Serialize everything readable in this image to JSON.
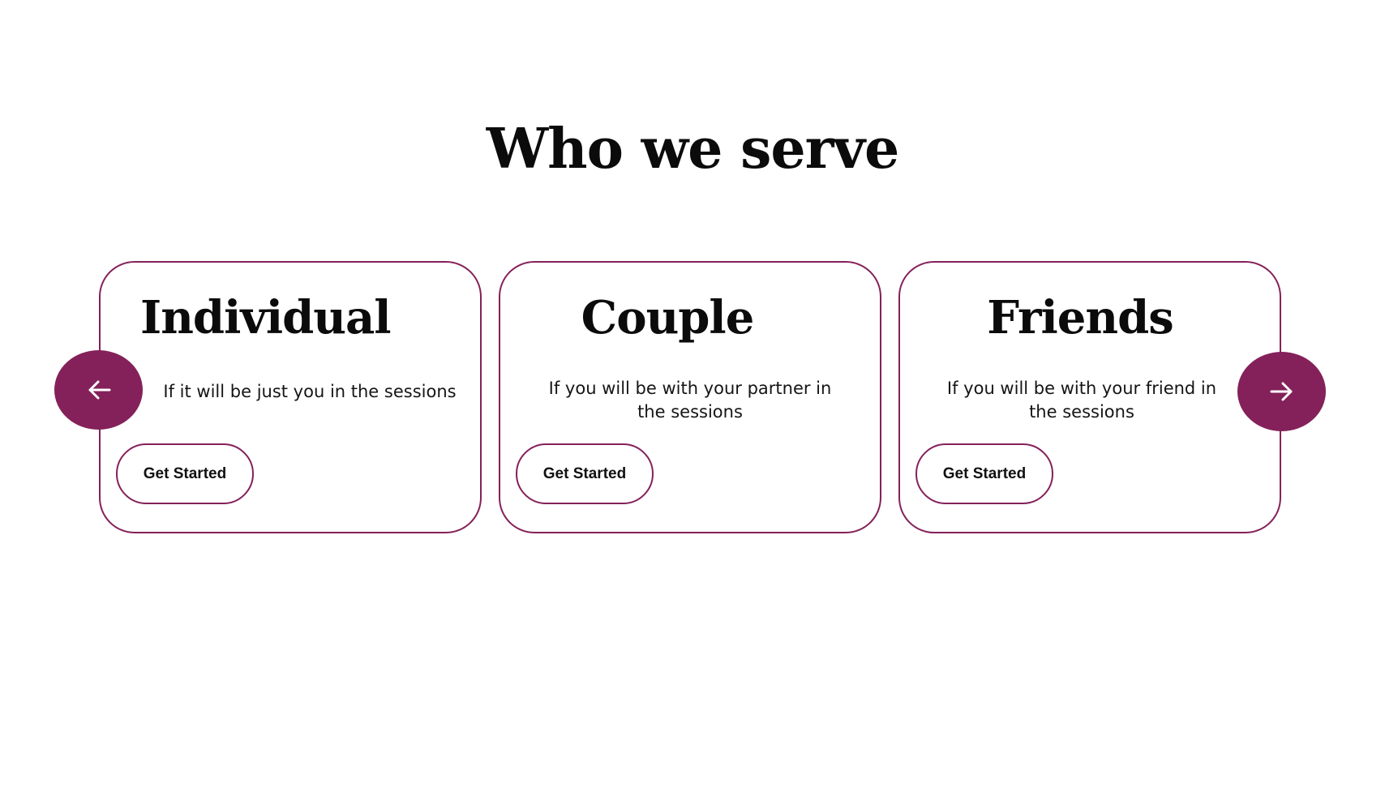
{
  "section": {
    "title": "Who we serve"
  },
  "cards": [
    {
      "title": "Individual",
      "description": "If it will be just you in the sessions",
      "button_label": "Get Started"
    },
    {
      "title": "Couple",
      "description": "If you will be with your partner in the sessions",
      "button_label": "Get Started"
    },
    {
      "title": "Friends",
      "description": "If you will be with your friend in the sessions",
      "button_label": "Get Started"
    }
  ],
  "carousel": {
    "prev_icon": "arrow-left-icon",
    "next_icon": "arrow-right-icon"
  },
  "colors": {
    "accent": "#84215a",
    "text": "#111111",
    "background": "#ffffff"
  }
}
